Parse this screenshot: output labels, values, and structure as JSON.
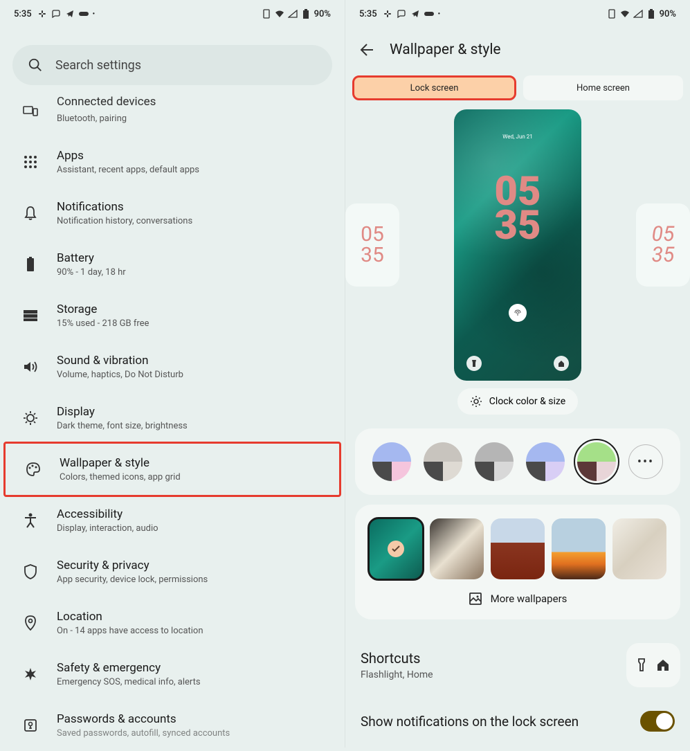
{
  "status": {
    "time": "5:35",
    "battery": "90%"
  },
  "search": {
    "placeholder": "Search settings"
  },
  "settings": [
    {
      "title": "Connected devices",
      "subtitle": "Bluetooth, pairing",
      "icon": "devices"
    },
    {
      "title": "Apps",
      "subtitle": "Assistant, recent apps, default apps",
      "icon": "apps"
    },
    {
      "title": "Notifications",
      "subtitle": "Notification history, conversations",
      "icon": "bell"
    },
    {
      "title": "Battery",
      "subtitle": "90% - 1 day, 18 hr",
      "icon": "battery"
    },
    {
      "title": "Storage",
      "subtitle": "15% used - 218 GB free",
      "icon": "storage"
    },
    {
      "title": "Sound & vibration",
      "subtitle": "Volume, haptics, Do Not Disturb",
      "icon": "sound"
    },
    {
      "title": "Display",
      "subtitle": "Dark theme, font size, brightness",
      "icon": "display"
    },
    {
      "title": "Wallpaper & style",
      "subtitle": "Colors, themed icons, app grid",
      "icon": "palette"
    },
    {
      "title": "Accessibility",
      "subtitle": "Display, interaction, audio",
      "icon": "accessibility"
    },
    {
      "title": "Security & privacy",
      "subtitle": "App security, device lock, permissions",
      "icon": "shield"
    },
    {
      "title": "Location",
      "subtitle": "On - 14 apps have access to location",
      "icon": "location"
    },
    {
      "title": "Safety & emergency",
      "subtitle": "Emergency SOS, medical info, alerts",
      "icon": "star"
    },
    {
      "title": "Passwords & accounts",
      "subtitle": "Saved passwords, autofill, synced accounts",
      "icon": "key"
    }
  ],
  "ws": {
    "title": "Wallpaper & style",
    "tabs": {
      "lock": "Lock screen",
      "home": "Home screen"
    },
    "clock_color_btn": "Clock color & size",
    "more_wallpapers": "More wallpapers",
    "shortcuts": {
      "title": "Shortcuts",
      "subtitle": "Flashlight, Home"
    },
    "notifications_toggle": "Show notifications on the lock screen",
    "lock_preview": {
      "date": "Wed, Jun 21",
      "time_top": "05",
      "time_bot": "35"
    },
    "side_clock": {
      "top": "05",
      "bot": "35"
    }
  },
  "palettes": [
    {
      "tl": "#a5b8f0",
      "tr": "#a5b8f0",
      "bl": "#4a4a4a",
      "br": "#f5c5dd"
    },
    {
      "tl": "#c8c4be",
      "tr": "#c8c4be",
      "bl": "#4a4a4a",
      "br": "#dedad3"
    },
    {
      "tl": "#b5b5b5",
      "tr": "#b5b5b5",
      "bl": "#4a4a4a",
      "br": "#d8d8d8"
    },
    {
      "tl": "#a5b8f0",
      "tr": "#a5b8f0",
      "bl": "#4a4a4a",
      "br": "#d8cef5"
    },
    {
      "tl": "#a5e088",
      "tr": "#a5e088",
      "bl": "#5c3838",
      "br": "#e8d5d8",
      "selected": true
    }
  ],
  "wallpapers": [
    {
      "bg": "linear-gradient(135deg,#0a6b5f,#1a9b85,#0d5a4f)",
      "selected": true
    },
    {
      "bg": "linear-gradient(135deg,#3a3530,#e8e0d0,#8a7560)"
    },
    {
      "bg": "linear-gradient(180deg,#c8d8e8 40%,#8a3520 40%,#7a2510)"
    },
    {
      "bg": "linear-gradient(180deg,#b8d0e0 55%,#f5a030 55%,#e07020 75%,#4a2818)"
    },
    {
      "bg": "linear-gradient(135deg,#f0ede5,#d8d0c0,#e8e0d5)"
    }
  ]
}
